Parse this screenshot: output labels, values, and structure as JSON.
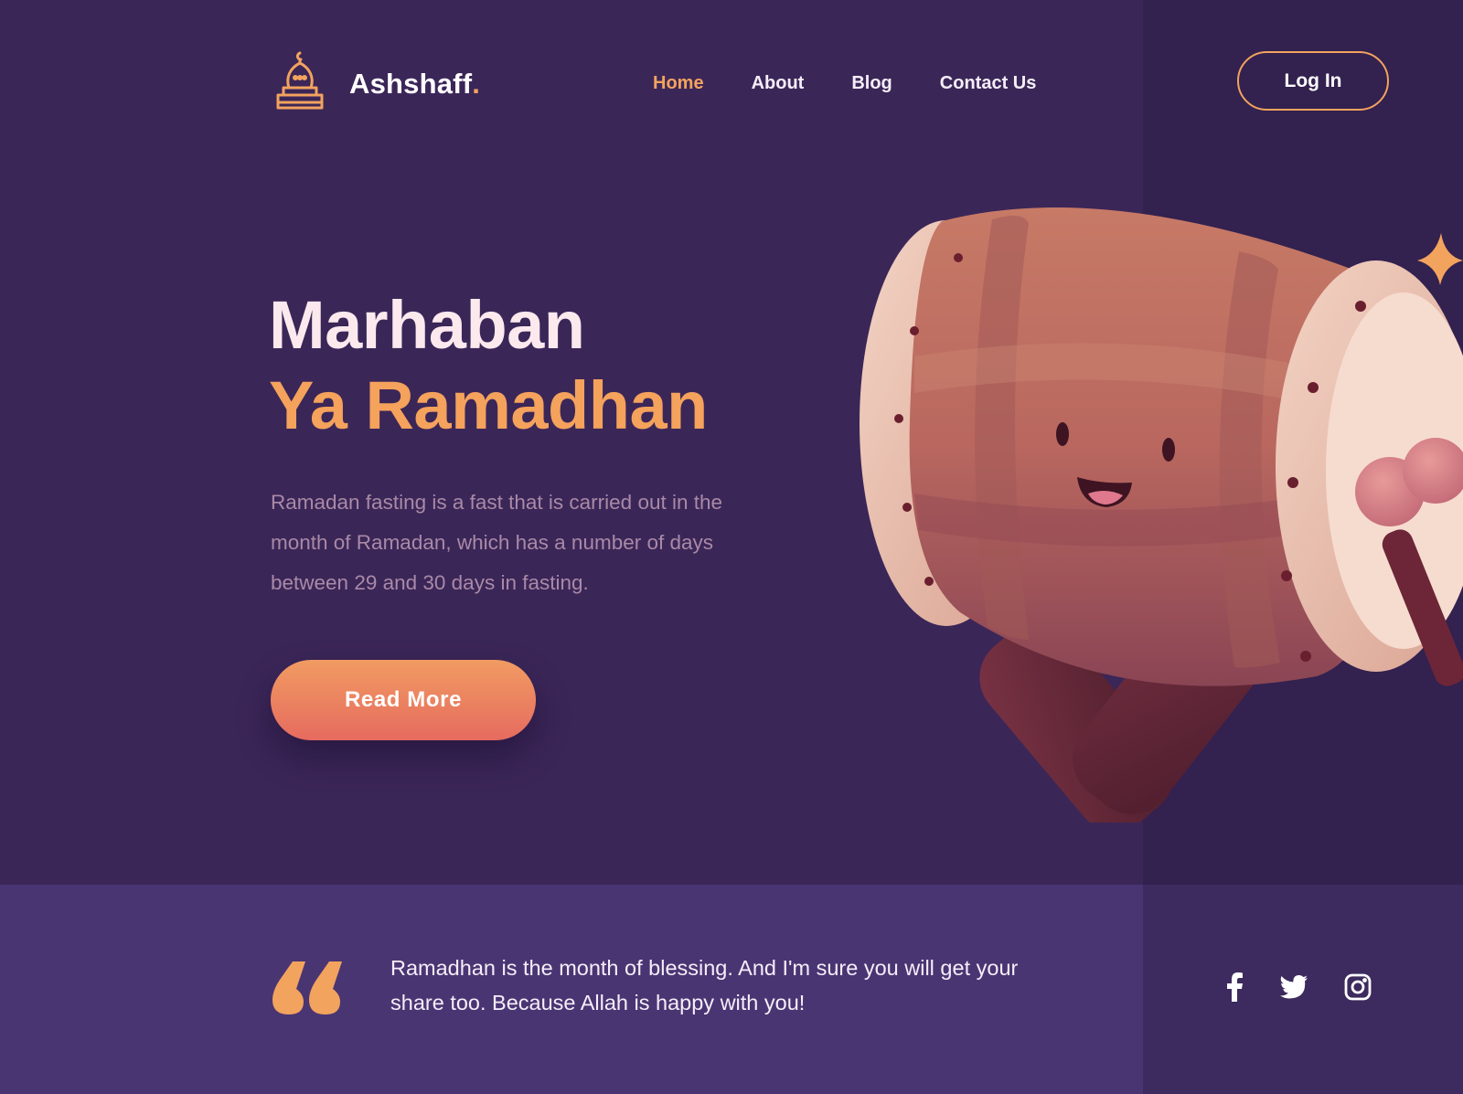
{
  "brand": {
    "name": "Ashshaff",
    "dot": ".",
    "logo_icon": "mosque-icon"
  },
  "nav": {
    "items": [
      {
        "label": "Home",
        "active": true
      },
      {
        "label": "About",
        "active": false
      },
      {
        "label": "Blog",
        "active": false
      },
      {
        "label": "Contact Us",
        "active": false
      }
    ],
    "login_label": "Log In"
  },
  "hero": {
    "title_line1": "Marhaban",
    "title_line2": "Ya Ramadhan",
    "description": "Ramadan fasting is a fast that is carried out in the month of Ramadan, which has a number of days between 29 and 30 days in fasting.",
    "cta_label": "Read More",
    "illustration": "bedug-drum-character"
  },
  "quote": {
    "text": "Ramadhan is the month of blessing. And I'm sure you will get your share too. Because Allah is happy with you!"
  },
  "socials": [
    {
      "name": "facebook-icon"
    },
    {
      "name": "twitter-icon"
    },
    {
      "name": "instagram-icon"
    }
  ],
  "colors": {
    "background": "#3b2658",
    "accent": "#f2a35e",
    "button_gradient_start": "#f19b62",
    "button_gradient_end": "#e66b5f",
    "band": "#4a3573"
  }
}
